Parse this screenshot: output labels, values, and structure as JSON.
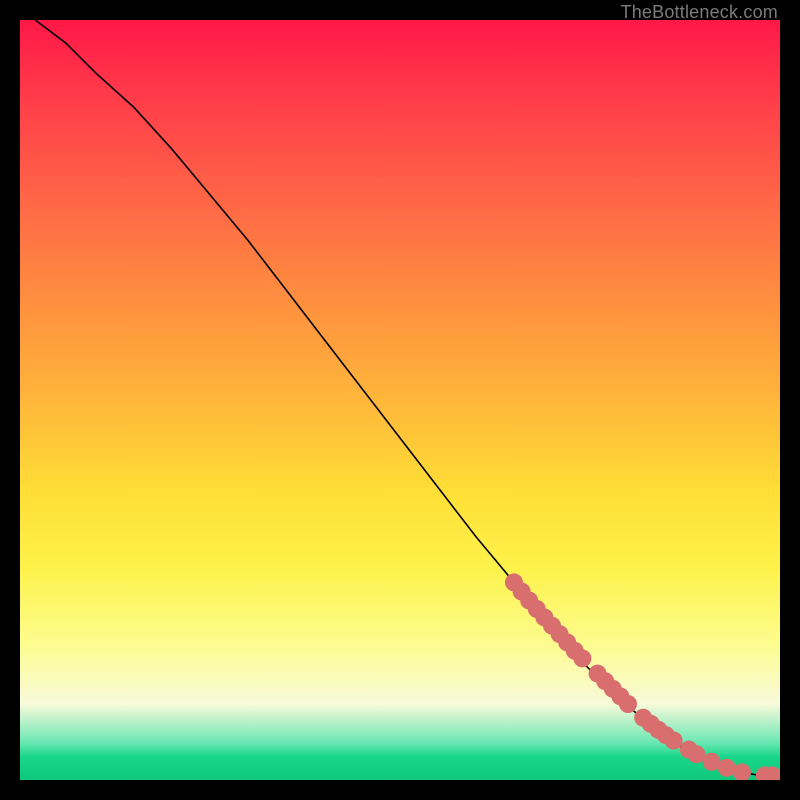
{
  "watermark": "TheBottleneck.com",
  "colors": {
    "frame": "#000000",
    "watermark": "#7b7b7b",
    "curve": "#000000",
    "point": "#d96e6e",
    "gradient_stops": [
      "#ff1846",
      "#ff3b4a",
      "#ff6a46",
      "#ff8f3f",
      "#ffb63a",
      "#ffde36",
      "#fdf24a",
      "#fdfc8e",
      "#f8fada",
      "#6de8b5",
      "#17d688",
      "#0fc87c"
    ]
  },
  "chart_data": {
    "type": "line",
    "title": "",
    "xlabel": "",
    "ylabel": "",
    "xlim": [
      0,
      100
    ],
    "ylim": [
      0,
      100
    ],
    "legend": false,
    "grid": false,
    "note": "Plot displayed on a vertical color-gradient background (red at top through yellow to green at bottom). Axes have no visible tick labels in the image; values below are read as percentages of plot extent.",
    "series": [
      {
        "name": "curve",
        "kind": "line",
        "x": [
          2,
          6,
          10,
          15,
          20,
          25,
          30,
          35,
          40,
          45,
          50,
          55,
          60,
          65,
          68,
          73,
          78,
          82,
          86,
          89,
          92,
          95,
          98,
          100
        ],
        "y": [
          100,
          97,
          93,
          88.5,
          83,
          77,
          71,
          64.5,
          58,
          51.5,
          45,
          38.5,
          32,
          26,
          22,
          16.5,
          11.5,
          8,
          5,
          3,
          1.8,
          1,
          0.5,
          0.5
        ]
      },
      {
        "name": "points",
        "kind": "scatter",
        "x": [
          65,
          66,
          67,
          68,
          69,
          70,
          71,
          72,
          73,
          74,
          76,
          77,
          78,
          79,
          80,
          82,
          83,
          84,
          85,
          86,
          88,
          89,
          91,
          93,
          95,
          98,
          99
        ],
        "y": [
          26.0,
          24.8,
          23.6,
          22.5,
          21.4,
          20.3,
          19.2,
          18.1,
          17.0,
          16.0,
          14.0,
          13.0,
          12.0,
          11.0,
          10.0,
          8.2,
          7.4,
          6.6,
          5.9,
          5.2,
          4.0,
          3.4,
          2.4,
          1.6,
          1.0,
          0.6,
          0.6
        ]
      }
    ]
  }
}
